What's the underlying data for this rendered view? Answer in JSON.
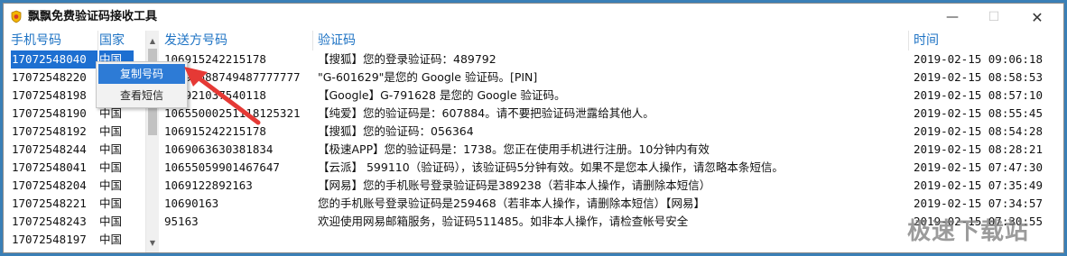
{
  "window": {
    "title": "飘飘免费验证码接收工具",
    "minimize_glyph": "—",
    "maximize_glyph": "☐",
    "close_glyph": "✕"
  },
  "left_panel": {
    "columns": [
      "手机号码",
      "国家"
    ],
    "rows": [
      {
        "phone": "17072548040",
        "country": "中国"
      },
      {
        "phone": "17072548220",
        "country": "中国"
      },
      {
        "phone": "17072548198",
        "country": "中国"
      },
      {
        "phone": "17072548190",
        "country": "中国"
      },
      {
        "phone": "17072548192",
        "country": "中国"
      },
      {
        "phone": "17072548244",
        "country": "中国"
      },
      {
        "phone": "17072548041",
        "country": "中国"
      },
      {
        "phone": "17072548204",
        "country": "中国"
      },
      {
        "phone": "17072548221",
        "country": "中国"
      },
      {
        "phone": "17072548243",
        "country": "中国"
      },
      {
        "phone": "17072548197",
        "country": "中国"
      }
    ],
    "selected_index": 0
  },
  "context_menu": {
    "items": [
      "复制号码",
      "查看短信"
    ],
    "active_index": 0
  },
  "right_panel": {
    "columns": [
      "发送方号码",
      "验证码",
      "时间"
    ],
    "rows": [
      {
        "sender": "106915242215178",
        "code": "【搜狐】您的登录验证码：489792",
        "time": "2019-02-15 09:06:18"
      },
      {
        "sender": "10691688749487777777",
        "code": "\"G-601629\"是您的 Google 验证码。[PIN]",
        "time": "2019-02-15 08:58:53"
      },
      {
        "sender": "106921037540118",
        "code": "【Google】G-791628 是您的 Google 验证码。",
        "time": "2019-02-15 08:57:10"
      },
      {
        "sender": "10655000251118125321",
        "code": "【纯爱】您的验证码是：607884。请不要把验证码泄露给其他人。",
        "time": "2019-02-15 08:55:45"
      },
      {
        "sender": "106915242215178",
        "code": "【搜狐】您的验证码：056364",
        "time": "2019-02-15 08:54:28"
      },
      {
        "sender": "1069063630381834",
        "code": "【极速APP】您的验证码是：1738。您正在使用手机进行注册。10分钟内有效",
        "time": "2019-02-15 08:28:21"
      },
      {
        "sender": "10655059901467647",
        "code": "【云派】 599110（验证码），该验证码5分钟有效。如果不是您本人操作，请忽略本条短信。",
        "time": "2019-02-15 07:47:30"
      },
      {
        "sender": "1069122892163",
        "code": "【网易】您的手机账号登录验证码是389238（若非本人操作，请删除本短信）",
        "time": "2019-02-15 07:35:49"
      },
      {
        "sender": "10690163",
        "code": "您的手机账号登录验证码是259468（若非本人操作，请删除本短信）【网易】",
        "time": "2019-02-15 07:34:57"
      },
      {
        "sender": "95163",
        "code": "欢迎使用网易邮箱服务，验证码511485。如非本人操作，请检查帐号安全",
        "time": "2019-02-15 07:30:55"
      }
    ]
  },
  "watermark": "极速下载站",
  "colors": {
    "header_text": "#1e73c4",
    "selection": "#1d6fd1",
    "menu_highlight": "#2d7bd6",
    "arrow": "#e53935",
    "desktop_bg": "#3a7fb6"
  }
}
